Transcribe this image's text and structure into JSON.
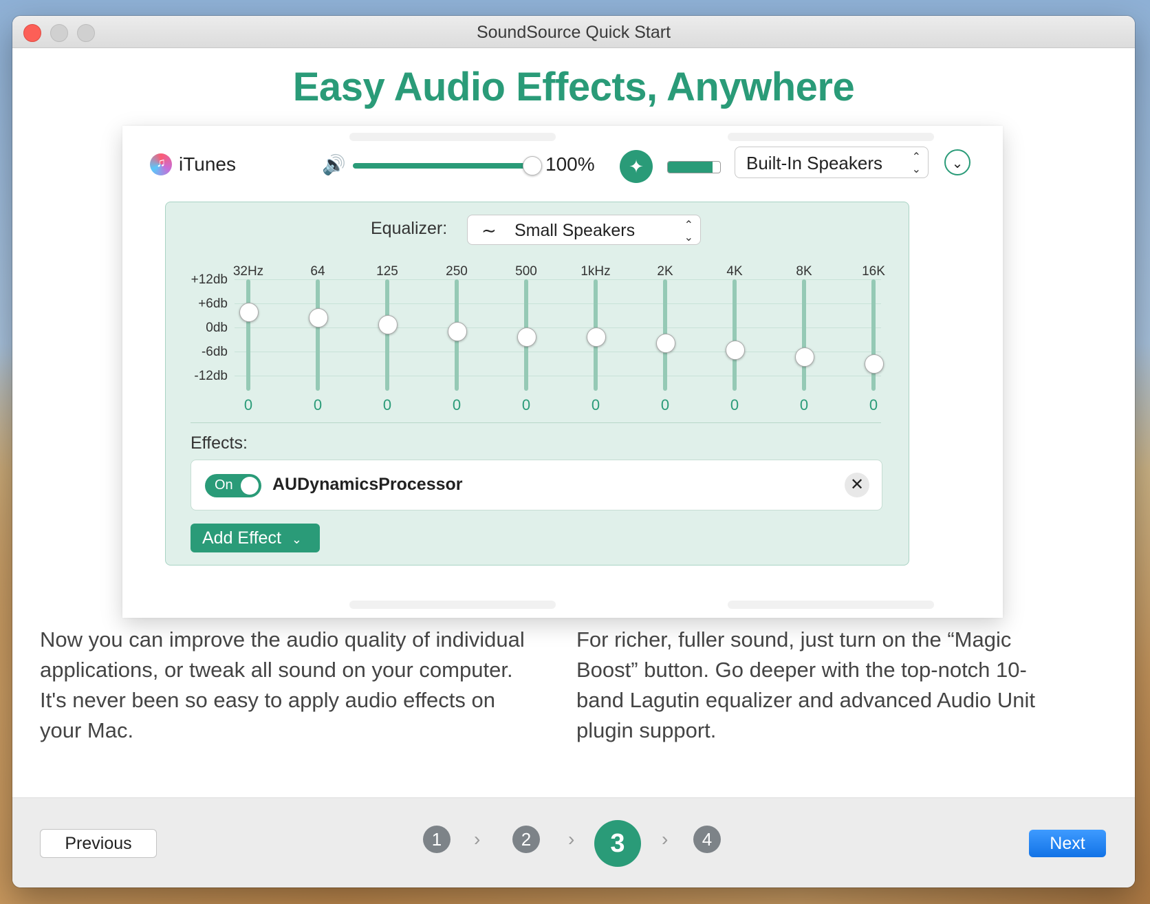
{
  "window": {
    "title": "SoundSource Quick Start"
  },
  "headline": "Easy Audio Effects, Anywhere",
  "app_row": {
    "name": "iTunes",
    "volume_percent": 100,
    "volume_label": "100%",
    "meter_level": 0.85,
    "device": "Built-In Speakers"
  },
  "equalizer": {
    "label": "Equalizer:",
    "preset": "Small Speakers",
    "db_labels": [
      "+12db",
      "+6db",
      "0db",
      "-6db",
      "-12db"
    ],
    "bands": [
      {
        "freq": "32Hz",
        "value": "0",
        "slider": 0.71
      },
      {
        "freq": "64",
        "value": "0",
        "slider": 0.66
      },
      {
        "freq": "125",
        "value": "0",
        "slider": 0.6
      },
      {
        "freq": "250",
        "value": "0",
        "slider": 0.54
      },
      {
        "freq": "500",
        "value": "0",
        "slider": 0.49
      },
      {
        "freq": "1kHz",
        "value": "0",
        "slider": 0.49
      },
      {
        "freq": "2K",
        "value": "0",
        "slider": 0.43
      },
      {
        "freq": "4K",
        "value": "0",
        "slider": 0.37
      },
      {
        "freq": "8K",
        "value": "0",
        "slider": 0.31
      },
      {
        "freq": "16K",
        "value": "0",
        "slider": 0.25
      }
    ]
  },
  "effects": {
    "label": "Effects:",
    "items": [
      {
        "toggle_label": "On",
        "name": "AUDynamicsProcessor"
      }
    ],
    "add_label": "Add Effect"
  },
  "captions": {
    "left": "Now you can improve the audio quality of individual applications, or tweak all sound on your computer. It's never been so easy to apply audio effects on your Mac.",
    "right": "For richer, fuller sound, just turn on the “Magic Boost” button. Go deeper with the top-notch 10-band Lagutin equalizer and advanced Audio Unit plugin support."
  },
  "footer": {
    "previous": "Previous",
    "next": "Next",
    "steps": [
      "1",
      "2",
      "3",
      "4"
    ],
    "current_step": "3"
  },
  "colors": {
    "accent": "#2a9b78",
    "next_button": "#1a7ff0"
  }
}
